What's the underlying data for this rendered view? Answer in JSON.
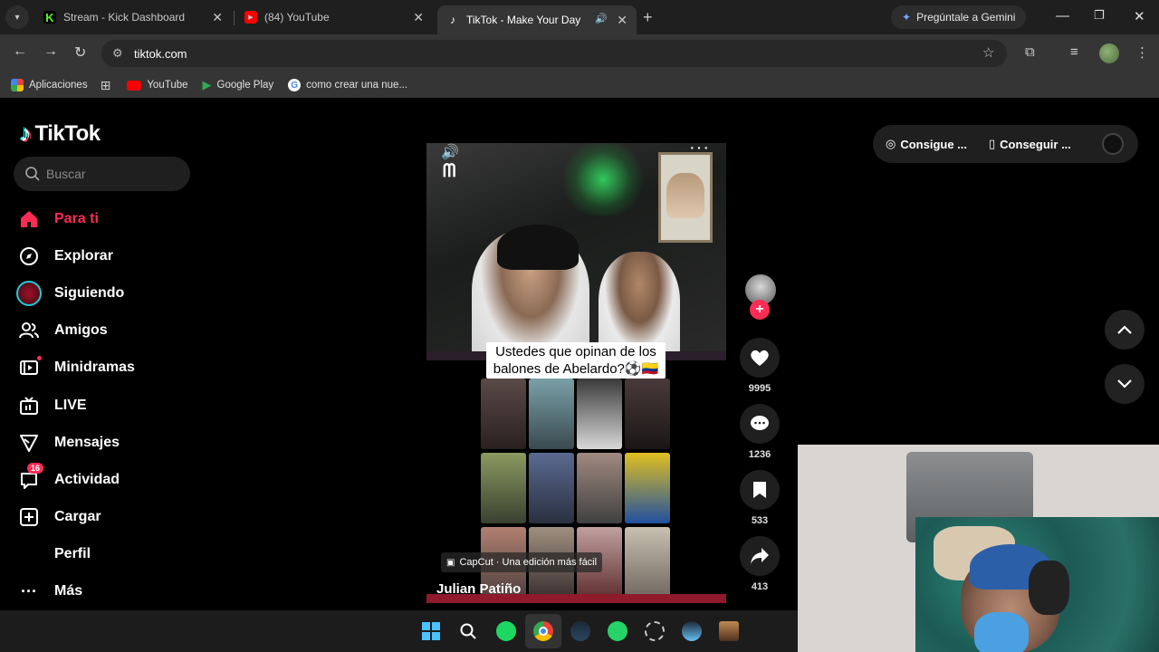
{
  "browser": {
    "tabs": [
      {
        "title": "Stream - Kick Dashboard",
        "icon": "kick-icon",
        "color": "#53fc18"
      },
      {
        "title": "(84) YouTube",
        "icon": "youtube-icon",
        "color": "#ff0000"
      },
      {
        "title": "TikTok - Make Your Day",
        "icon": "tiktok-icon",
        "active": true
      }
    ],
    "new_tab": "+",
    "gemini_label": "Pregúntale a Gemini",
    "url": "tiktok.com",
    "bookmarks": [
      {
        "label": "Aplicaciones",
        "icon": "apps-grid-icon"
      },
      {
        "label": "",
        "icon": "grid-icon"
      },
      {
        "label": "YouTube",
        "icon": "youtube-icon"
      },
      {
        "label": "Google Play",
        "icon": "google-play-icon"
      },
      {
        "label": "como crear una nue...",
        "icon": "google-icon"
      }
    ]
  },
  "tiktok": {
    "logo": "TikTok",
    "search_placeholder": "Buscar",
    "nav": [
      {
        "label": "Para ti",
        "icon": "home-icon",
        "active": true
      },
      {
        "label": "Explorar",
        "icon": "compass-icon"
      },
      {
        "label": "Siguiendo",
        "icon": "following-avatar-icon"
      },
      {
        "label": "Amigos",
        "icon": "friends-icon"
      },
      {
        "label": "Minidramas",
        "icon": "film-icon"
      },
      {
        "label": "LIVE",
        "icon": "live-tv-icon"
      },
      {
        "label": "Mensajes",
        "icon": "send-icon"
      },
      {
        "label": "Actividad",
        "icon": "activity-icon",
        "badge": "16"
      },
      {
        "label": "Cargar",
        "icon": "upload-icon"
      },
      {
        "label": "Perfil",
        "icon": "profile-icon"
      },
      {
        "label": "Más",
        "icon": "more-icon"
      }
    ],
    "video": {
      "caption_line1": "Ustedes que opinan de los",
      "caption_line2": "balones de Abelardo?⚽🇨🇴",
      "capcut": "CapCut · Una edición más fácil",
      "author": "Julian Patiño"
    },
    "actions": {
      "likes": "9995",
      "comments": "1236",
      "saves": "533",
      "shares": "413"
    },
    "top_buttons": {
      "coins": "Consigue ...",
      "app": "Conseguir ..."
    },
    "accent": "#fe2c55"
  },
  "taskbar": {
    "apps": [
      "windows-start-icon",
      "search-icon",
      "spotify-icon",
      "chrome-icon",
      "steam-icon",
      "whatsapp-icon",
      "discord-icon",
      "steam-icon",
      "game-icon"
    ]
  }
}
